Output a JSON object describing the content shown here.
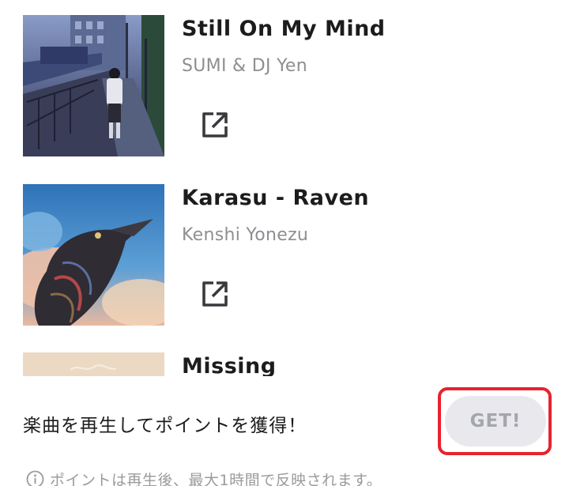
{
  "tracks": [
    {
      "title": "Still On My Mind",
      "artist": "SUMI & DJ Yen",
      "link_icon": "open-external-icon"
    },
    {
      "title": "Karasu - Raven",
      "artist": "Kenshi Yonezu",
      "link_icon": "open-external-icon"
    },
    {
      "title": "Missing",
      "artist": "",
      "link_icon": "open-external-icon"
    }
  ],
  "promo": {
    "text": "楽曲を再生してポイントを獲得！",
    "get_label": "GET!",
    "note": "ポイントは再生後、最大1時間で反映されます。",
    "info_icon": "info-circle-icon"
  },
  "colors": {
    "title": "#1c1c1e",
    "artist": "#8e8e93",
    "get_button_bg": "#e9e9ed",
    "get_button_text": "#a3a6ad",
    "highlight": "#e8222e"
  }
}
